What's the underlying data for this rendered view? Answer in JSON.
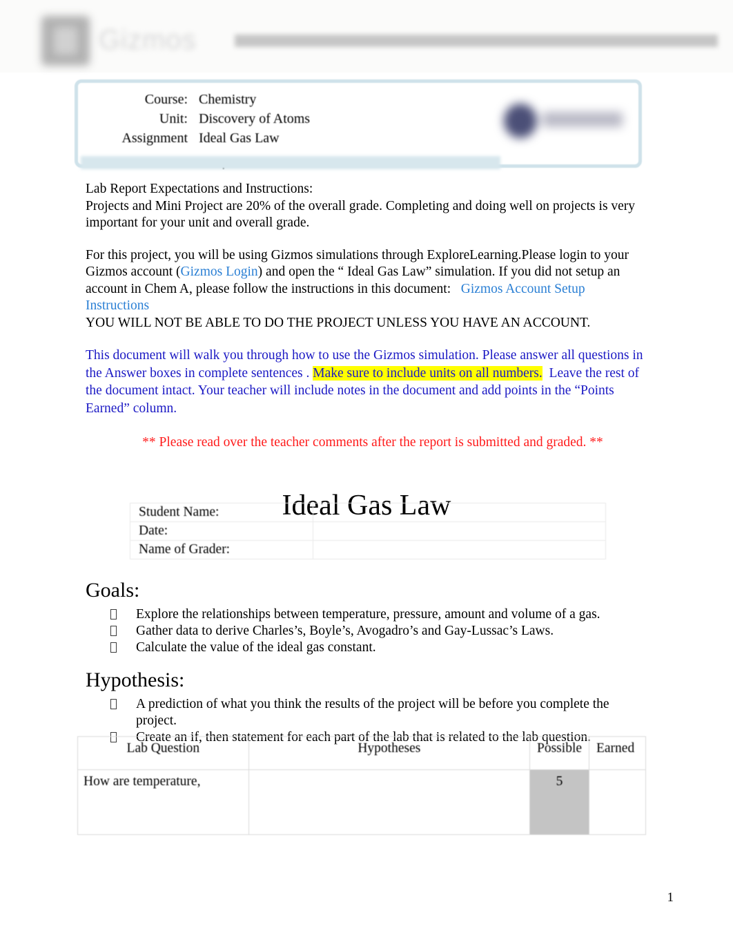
{
  "header": {
    "logo_word": "Gizmos",
    "logo_mark": "gizmos-logo-icon"
  },
  "course_box": {
    "rows": [
      {
        "label": "Course:",
        "value": "Chemistry"
      },
      {
        "label": "Unit:",
        "value": "Discovery of Atoms"
      },
      {
        "label": "Assignment",
        "value": "Ideal Gas Law"
      }
    ],
    "trailing_colon": ":",
    "logo": "school-logo-icon",
    "border_color": "#cfe2ea"
  },
  "instructions": {
    "heading": "Lab Report Expectations and Instructions:",
    "paragraph1": "Projects and Mini Project are 20% of the overall grade.  Completing and doing well on projects is very important for your unit and overall grade.",
    "paragraph2_pre": "For this project, you will be using Gizmos simulations through ExploreLearning.",
    "paragraph2_mid": "Please login to your Gizmos account (",
    "link_gizmos_login": "Gizmos Login",
    "paragraph2_after_link": ") and open the “ Ideal Gas Law” simulation.  If you did not setup an account in Chem A, please follow the instructions in this document:",
    "link_setup_instructions": "Gizmos Account Setup Instructions",
    "paragraph2_caps": "YOU WILL NOT BE ABLE TO DO THE PROJECT UNLESS YOU HAVE AN ACCOUNT.",
    "blue_part1": "This document will walk you through how to use the Gizmos simulation.    Please answer all questions in the Answer boxes in complete sentences   .",
    "blue_highlight": "Make sure to include units on all numbers.",
    "blue_part2": "Leave the rest of the document intact.    Your teacher will include notes in the document and add points in the “Points Earned” column.",
    "red_note": "** Please read over the teacher comments after the report is submitted and graded. **",
    "highlight_color": "#ffff00",
    "link_color": "#2a7fd4",
    "blue_text_color": "#1b19c4",
    "red_text_color": "#ff1a1a"
  },
  "title": "Ideal Gas Law",
  "student_info": {
    "rows": [
      {
        "label": "Student Name:",
        "value": ""
      },
      {
        "label": "Date:",
        "value": ""
      },
      {
        "label": "Name of Grader:",
        "value": ""
      }
    ]
  },
  "goals": {
    "heading": "Goals:",
    "items": [
      "Explore the relationships between temperature, pressure, amount and volume of a gas.",
      "Gather data to derive Charles’s, Boyle’s, Avogadro’s and Gay-Lussac’s Laws.",
      "Calculate the value of the ideal gas constant."
    ]
  },
  "hypothesis": {
    "heading": "Hypothesis:",
    "items": [
      "A prediction of what you think the results of the project will be before you complete the project.",
      "Create an if, then statement for each part of the lab that is related to the lab question."
    ]
  },
  "grade_table": {
    "headers": {
      "question": "Lab Question",
      "hypotheses": "Hypotheses",
      "possible": "Possible",
      "earned": "Earned"
    },
    "rows": [
      {
        "question": "How are temperature,",
        "hypotheses": "",
        "possible": "5",
        "earned": ""
      }
    ],
    "shade_color": "#c4c4c4"
  },
  "footer": {
    "page_number": "1"
  }
}
